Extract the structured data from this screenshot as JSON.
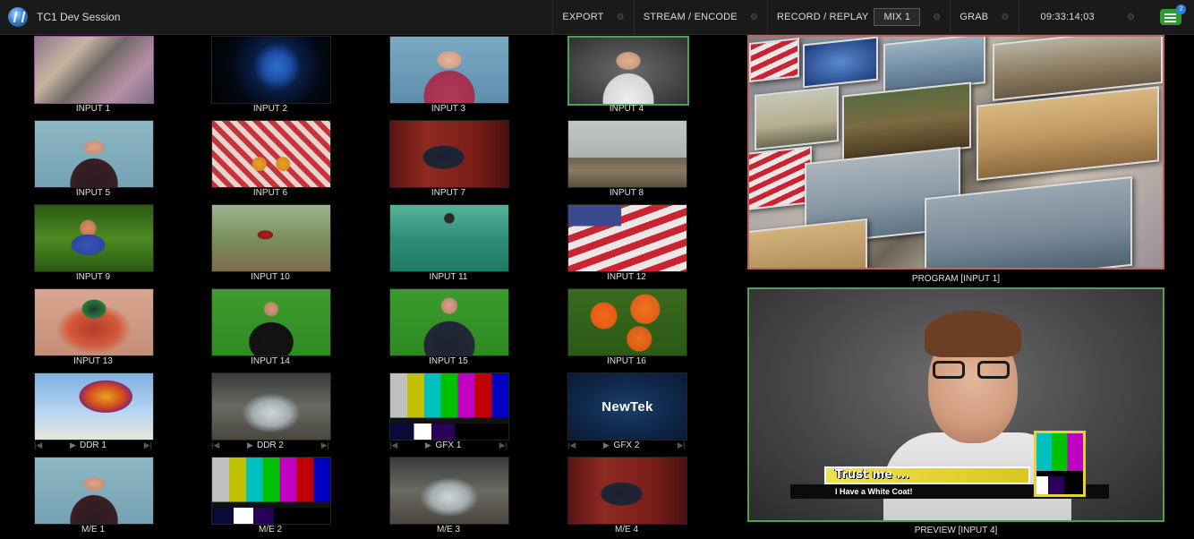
{
  "app": {
    "session_title": "TC1 Dev Session"
  },
  "toolbar": {
    "export": "EXPORT",
    "stream_encode": "STREAM / ENCODE",
    "record_replay": "RECORD / REPLAY",
    "mix": "MIX 1",
    "grab": "GRAB",
    "timecode": "09:33:14;03",
    "notification_count": "2"
  },
  "inputs": [
    {
      "label": "INPUT 1"
    },
    {
      "label": "INPUT 2"
    },
    {
      "label": "INPUT 3"
    },
    {
      "label": "INPUT 4"
    },
    {
      "label": "INPUT 5"
    },
    {
      "label": "INPUT 6"
    },
    {
      "label": "INPUT 7"
    },
    {
      "label": "INPUT 8"
    },
    {
      "label": "INPUT 9"
    },
    {
      "label": "INPUT 10"
    },
    {
      "label": "INPUT 11"
    },
    {
      "label": "INPUT 12"
    },
    {
      "label": "INPUT 13"
    },
    {
      "label": "INPUT 14"
    },
    {
      "label": "INPUT 15"
    },
    {
      "label": "INPUT 16"
    },
    {
      "label": "DDR 1"
    },
    {
      "label": "DDR 2"
    },
    {
      "label": "GFX 1"
    },
    {
      "label": "GFX 2"
    },
    {
      "label": "M/E 1"
    },
    {
      "label": "M/E 2"
    },
    {
      "label": "M/E 3"
    },
    {
      "label": "M/E 4"
    }
  ],
  "media_ctrl": {
    "prev": "|◀",
    "play": "▶",
    "next": "▶|"
  },
  "monitors": {
    "program": "PROGRAM [INPUT 1]",
    "preview": "PREVIEW [INPUT 4]"
  },
  "overlay": {
    "headline": "Trust me ...",
    "subline": "I Have a White Coat!"
  },
  "brand": {
    "logo_text": "NewTek"
  },
  "colors": {
    "program_border": "#c36060",
    "preview_border": "#4fa14f",
    "accent_yellow": "#e5d23a"
  }
}
